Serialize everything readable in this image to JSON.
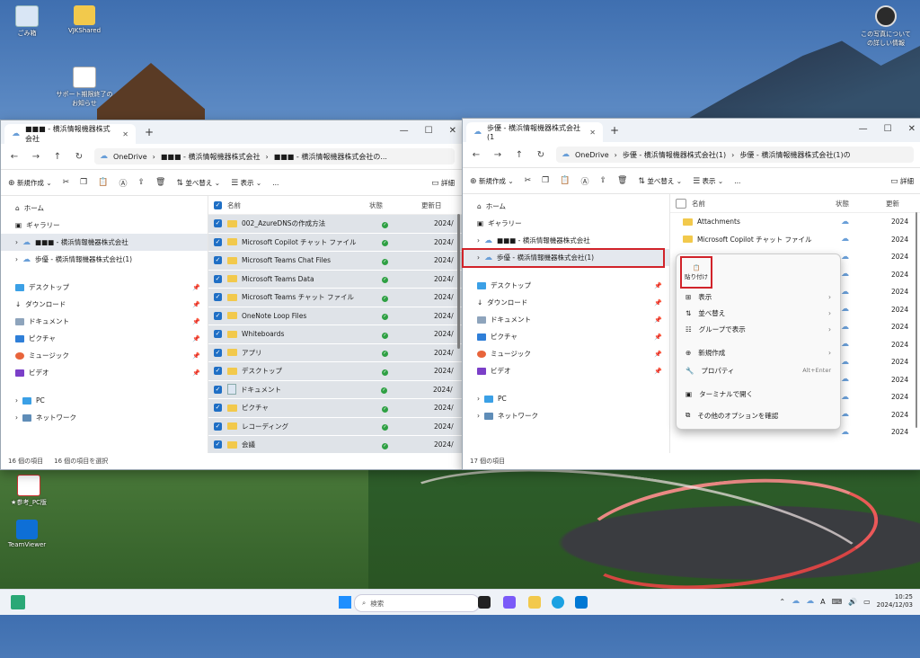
{
  "desktop": {
    "icons": [
      {
        "label": "ごみ箱"
      },
      {
        "label": "VJKShared"
      },
      {
        "label": "サポート期限終了のお知らせ"
      },
      {
        "label": "★参考_PC版"
      },
      {
        "label": "TeamViewer"
      }
    ],
    "photo_info": "この写真についての詳しい情報"
  },
  "left_window": {
    "tab_title": "■■■ - 横浜情報機器株式会社",
    "address": {
      "root": "OneDrive",
      "seg1": "■■■ - 横浜情報機器株式会社",
      "seg2": "■■■ - 横浜情報機器株式会社の..."
    },
    "toolbar": {
      "new": "新規作成",
      "sort": "並べ替え",
      "view": "表示",
      "more": "...",
      "details": "詳細"
    },
    "sidebar": [
      {
        "label": "ホーム"
      },
      {
        "label": "ギャラリー"
      },
      {
        "label": "■■■ - 横浜情報機器株式会社"
      },
      {
        "label": "歩優 - 横浜情報機器株式会社(1)"
      },
      {
        "label": "デスクトップ"
      },
      {
        "label": "ダウンロード"
      },
      {
        "label": "ドキュメント"
      },
      {
        "label": "ピクチャ"
      },
      {
        "label": "ミュージック"
      },
      {
        "label": "ビデオ"
      },
      {
        "label": "PC"
      },
      {
        "label": "ネットワーク"
      }
    ],
    "columns": {
      "name": "名前",
      "status": "状態",
      "modified": "更新日"
    },
    "files": [
      {
        "name": "002_AzureDNSの作成方法",
        "date": "2024/"
      },
      {
        "name": "Microsoft Copilot チャット ファイル",
        "date": "2024/"
      },
      {
        "name": "Microsoft Teams Chat Files",
        "date": "2024/"
      },
      {
        "name": "Microsoft Teams Data",
        "date": "2024/"
      },
      {
        "name": "Microsoft Teams チャット ファイル",
        "date": "2024/"
      },
      {
        "name": "OneNote Loop Files",
        "date": "2024/"
      },
      {
        "name": "Whiteboards",
        "date": "2024/"
      },
      {
        "name": "アプリ",
        "date": "2024/"
      },
      {
        "name": "デスクトップ",
        "date": "2024/"
      },
      {
        "name": "ドキュメント",
        "date": "2024/"
      },
      {
        "name": "ピクチャ",
        "date": "2024/"
      },
      {
        "name": "レコーディング",
        "date": "2024/"
      },
      {
        "name": "会議",
        "date": "2024/"
      },
      {
        "name": "添付ファイル",
        "date": "2024/"
      }
    ],
    "status": {
      "count": "16 個の項目",
      "selected": "16 個の項目を選択"
    }
  },
  "right_window": {
    "tab_title": "歩優 - 横浜情報機器株式会社(1",
    "address": {
      "root": "OneDrive",
      "seg1": "歩優 - 横浜情報機器株式会社(1)",
      "seg2": "歩優 - 横浜情報機器株式会社(1)の"
    },
    "toolbar": {
      "new": "新規作成",
      "sort": "並べ替え",
      "view": "表示",
      "more": "...",
      "details": "詳細"
    },
    "sidebar": [
      {
        "label": "ホーム"
      },
      {
        "label": "ギャラリー"
      },
      {
        "label": "■■■ - 横浜情報機器株式会社"
      },
      {
        "label": "歩優 - 横浜情報機器株式会社(1)"
      },
      {
        "label": "デスクトップ"
      },
      {
        "label": "ダウンロード"
      },
      {
        "label": "ドキュメント"
      },
      {
        "label": "ピクチャ"
      },
      {
        "label": "ミュージック"
      },
      {
        "label": "ビデオ"
      },
      {
        "label": "PC"
      },
      {
        "label": "ネットワーク"
      }
    ],
    "columns": {
      "name": "名前",
      "status": "状態",
      "modified": "更新"
    },
    "files": [
      {
        "name": "Attachments",
        "date": "2024"
      },
      {
        "name": "Microsoft Copilot チャット ファイル",
        "date": "2024"
      },
      {
        "name": "",
        "date": "2024"
      },
      {
        "name": "",
        "date": "2024"
      },
      {
        "name": "",
        "date": "2024"
      },
      {
        "name": "",
        "date": "2024"
      },
      {
        "name": "",
        "date": "2024"
      },
      {
        "name": "",
        "date": "2024"
      },
      {
        "name": "",
        "date": "2024"
      },
      {
        "name": "",
        "date": "2024"
      },
      {
        "name": "",
        "date": "2024"
      },
      {
        "name": "",
        "date": "2024"
      },
      {
        "name": "",
        "date": "2024"
      }
    ],
    "status": {
      "count": "17 個の項目"
    }
  },
  "context_menu": {
    "paste": "貼り付け",
    "items": [
      {
        "label": "表示"
      },
      {
        "label": "並べ替え"
      },
      {
        "label": "グループで表示"
      },
      {
        "label": "新規作成"
      },
      {
        "label": "プロパティ",
        "shortcut": "Alt+Enter"
      },
      {
        "label": "ターミナルで開く"
      },
      {
        "label": "その他のオプションを確認"
      }
    ]
  },
  "taskbar": {
    "search_placeholder": "検索",
    "time": "10:25",
    "date": "2024/12/03"
  }
}
